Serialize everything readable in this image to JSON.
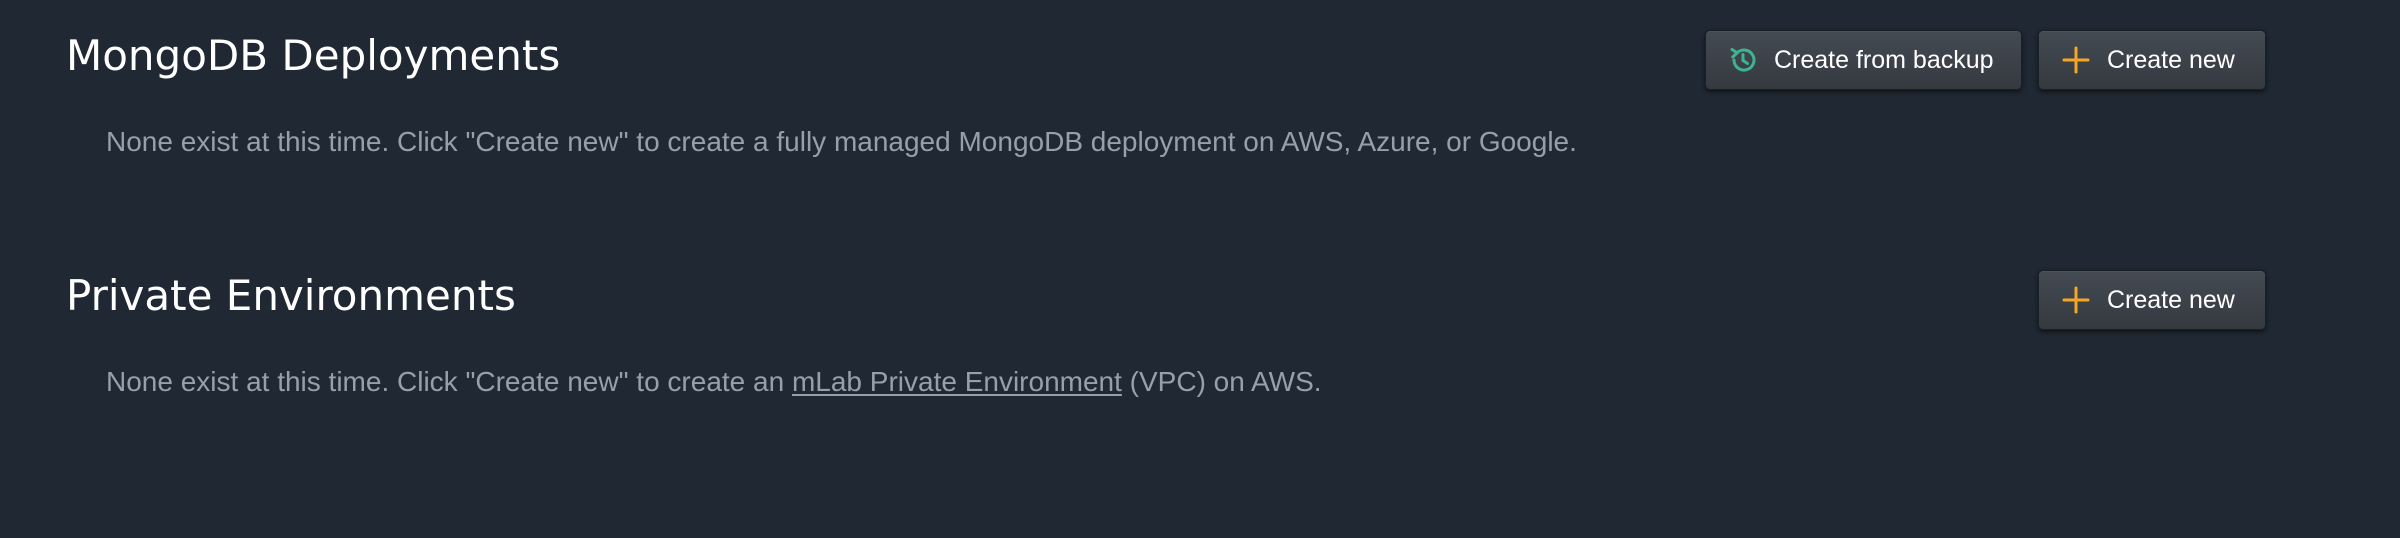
{
  "deployments": {
    "title": "MongoDB Deployments",
    "description": "None exist at this time. Click \"Create new\" to create a fully managed MongoDB deployment on AWS, Azure, or Google.",
    "create_from_backup_label": "Create from backup",
    "create_new_label": "Create new",
    "backup_icon": "history-icon",
    "plus_icon": "plus-icon"
  },
  "private_environments": {
    "title": "Private Environments",
    "description_before": "None exist at this time. Click \"Create new\" to create an ",
    "link_text": "mLab Private Environment",
    "description_after": " (VPC) on AWS.",
    "create_new_label": "Create new",
    "plus_icon": "plus-icon"
  },
  "colors": {
    "background": "#1f2833",
    "title_text": "#ffffff",
    "description_text": "#97a0aa",
    "button_background": "#3d4249",
    "plus_icon": "#f5a623",
    "backup_icon": "#3fb38f"
  }
}
